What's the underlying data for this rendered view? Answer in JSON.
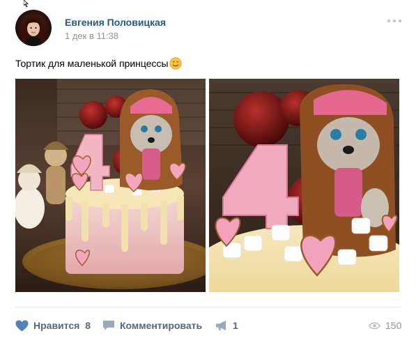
{
  "post": {
    "author_name": "Евгения Половицкая",
    "date": "1 дек в 11:38",
    "text": "Тортик для маленькой принцессы",
    "emoji_icon": "smiling-face-emoji",
    "photos": [
      {
        "icon": "cake-photo-full"
      },
      {
        "icon": "cake-photo-closeup"
      }
    ]
  },
  "actions": {
    "like_label": "Нравится",
    "like_count": "8",
    "comment_label": "Комментировать",
    "share_count": "1",
    "views_count": "150"
  },
  "colors": {
    "link": "#2a5885",
    "action_text": "#55677d",
    "muted": "#939393",
    "divider": "#e7e8ec"
  }
}
